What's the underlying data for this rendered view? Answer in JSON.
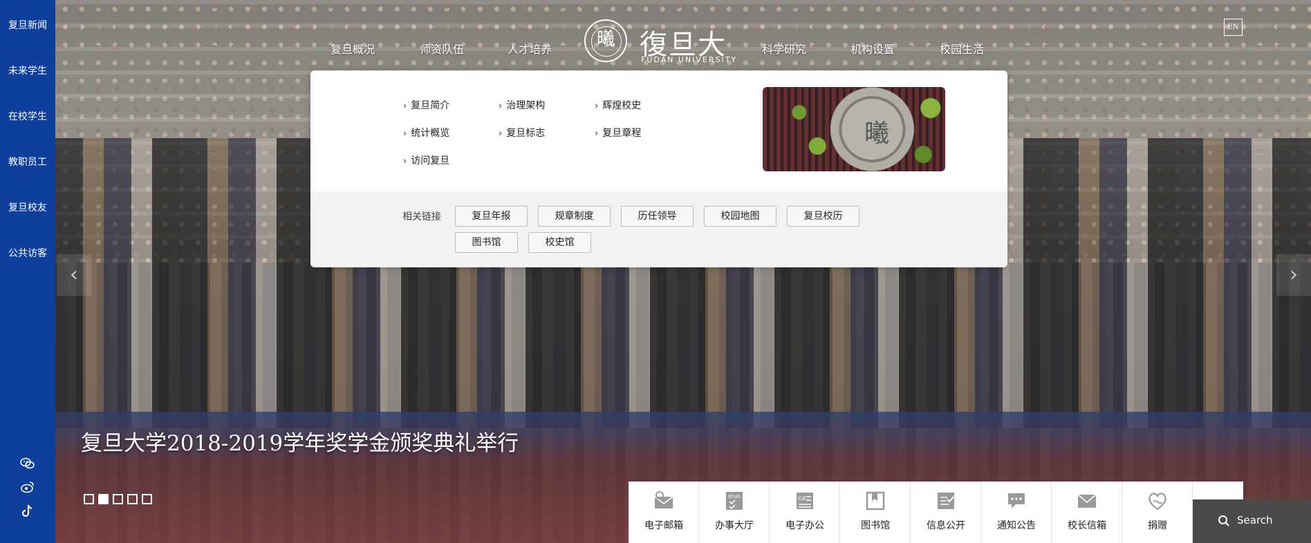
{
  "sidebar": {
    "items": [
      "复旦新闻",
      "未来学生",
      "在校学生",
      "教职员工",
      "复旦校友",
      "公共访客"
    ],
    "social_icons": [
      "wechat-icon",
      "weibo-icon",
      "douyin-icon"
    ]
  },
  "topnav": {
    "left": [
      "复旦概况",
      "师资队伍",
      "人才培养"
    ],
    "right": [
      "科学研究",
      "机构设置",
      "校园生活"
    ]
  },
  "logo": {
    "seal_char": "曦",
    "cn": "復旦大學",
    "en": "FUDAN UNIVERSITY"
  },
  "lang_button": "EN",
  "dropdown": {
    "menu": [
      "复旦简介",
      "治理架构",
      "辉煌校史",
      "统计概览",
      "复旦标志",
      "复旦章程",
      "访问复旦"
    ],
    "thumb_char": "曦",
    "related_label": "相关链接",
    "related": [
      "复旦年报",
      "规章制度",
      "历任领导",
      "校园地图",
      "复旦校历",
      "图书馆",
      "校史馆"
    ]
  },
  "headline": "复旦大学2018-2019学年奖学金颁奖典礼举行",
  "carousel": {
    "count": 5,
    "active_index": 1
  },
  "quicklinks": [
    {
      "label": "电子邮箱",
      "icon": "mail-icon"
    },
    {
      "label": "办事大厅",
      "icon": "service-hall-icon"
    },
    {
      "label": "电子办公",
      "icon": "office-icon"
    },
    {
      "label": "图书馆",
      "icon": "library-icon"
    },
    {
      "label": "信息公开",
      "icon": "info-public-icon"
    },
    {
      "label": "通知公告",
      "icon": "notice-icon"
    },
    {
      "label": "校长信箱",
      "icon": "president-mail-icon"
    },
    {
      "label": "捐赠",
      "icon": "donate-icon"
    }
  ],
  "search": {
    "label": "Search"
  },
  "colors": {
    "sidebar_blue": "#0e3f9c",
    "quickbar_bg": "#ffffff",
    "search_bg": "#4a4a4a"
  }
}
